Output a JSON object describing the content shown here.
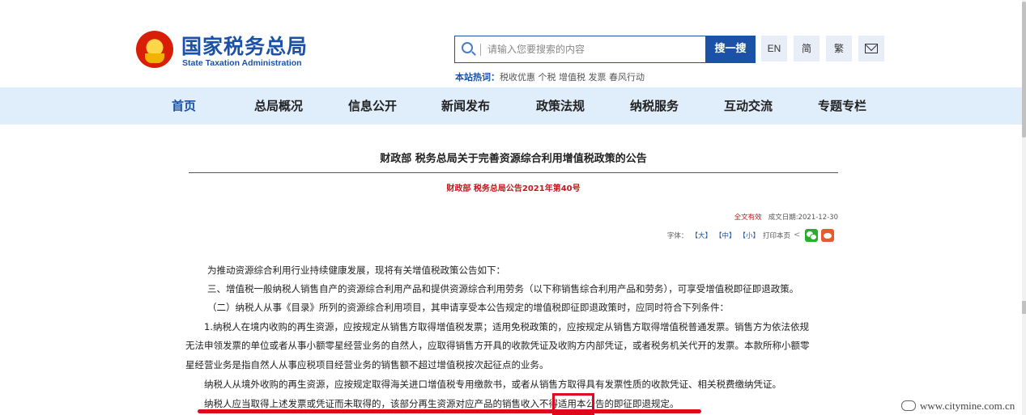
{
  "header": {
    "logo_cn": "国家税务总局",
    "logo_en": "State Taxation Administration",
    "search": {
      "placeholder": "请输入您要搜索的内容",
      "button": "搜一搜"
    },
    "tools": {
      "en": "EN",
      "simplified": "简",
      "traditional": "繁"
    },
    "hot": {
      "label": "本站热词：",
      "words": "税收优惠  个税  增值税  发票  春风行动"
    }
  },
  "nav": {
    "items": [
      "首页",
      "总局概况",
      "信息公开",
      "新闻发布",
      "政策法规",
      "纳税服务",
      "互动交流",
      "专题专栏"
    ]
  },
  "article": {
    "title": "财政部 税务总局关于完善资源综合利用增值税政策的公告",
    "doc_no": "财政部 税务总局公告2021年第40号",
    "status": "全文有效",
    "date": "成文日期:2021-12-30",
    "font_label": "字体：",
    "font_large": "【大】",
    "font_medium": "【中】",
    "font_small": "【小】",
    "print": "打印本页",
    "paragraphs": [
      "为推动资源综合利用行业持续健康发展，现将有关增值税政策公告如下：",
      "三、增值税一般纳税人销售自产的资源综合利用产品和提供资源综合利用劳务（以下称销售综合利用产品和劳务），可享受增值税即征即退政策。",
      "（二）纳税人从事《目录》所列的资源综合利用项目，其申请享受本公告规定的增值税即征即退政策时，应同时符合下列条件：",
      "1.纳税人在境内收购的再生资源，应按规定从销售方取得增值税发票；适用免税政策的，应按规定从销售方取得增值税普通发票。销售方为依法依规",
      "无法申领发票的单位或者从事小额零星经营业务的自然人，应取得销售方开具的收款凭证及收购方内部凭证，或者税务机关代开的发票。本款所称小额零",
      "星经营业务是指自然人从事应税项目经营业务的销售额不超过增值税按次起征点的业务。",
      "纳税人从境外收购的再生资源，应按规定取得海关进口增值税专用缴款书，或者从销售方取得具有发票性质的收款凭证、相关税费缴纳凭证。",
      "纳税人应当取得上述发票或凭证而未取得的，该部分再生资源对应产品的销售收入不得适用本公告的即征即退规定。"
    ]
  },
  "watermark": "www.citymine.com.cn",
  "colors": {
    "brand": "#1b52a7",
    "accent_red": "#c8161d",
    "nav_bg": "#e0edfa",
    "highlight": "#e0061b"
  }
}
